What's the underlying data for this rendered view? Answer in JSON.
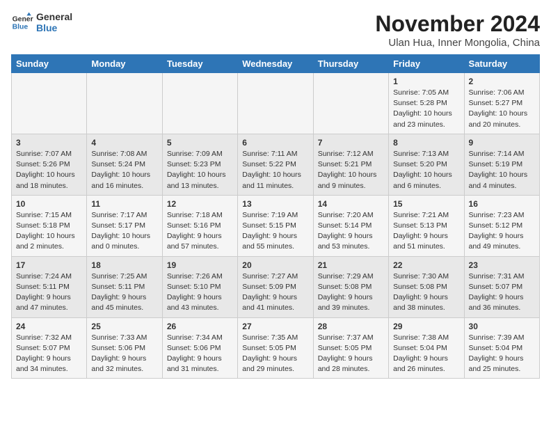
{
  "header": {
    "logo_line1": "General",
    "logo_line2": "Blue",
    "month": "November 2024",
    "location": "Ulan Hua, Inner Mongolia, China"
  },
  "days_of_week": [
    "Sunday",
    "Monday",
    "Tuesday",
    "Wednesday",
    "Thursday",
    "Friday",
    "Saturday"
  ],
  "weeks": [
    [
      {
        "day": "",
        "info": ""
      },
      {
        "day": "",
        "info": ""
      },
      {
        "day": "",
        "info": ""
      },
      {
        "day": "",
        "info": ""
      },
      {
        "day": "",
        "info": ""
      },
      {
        "day": "1",
        "info": "Sunrise: 7:05 AM\nSunset: 5:28 PM\nDaylight: 10 hours\nand 23 minutes."
      },
      {
        "day": "2",
        "info": "Sunrise: 7:06 AM\nSunset: 5:27 PM\nDaylight: 10 hours\nand 20 minutes."
      }
    ],
    [
      {
        "day": "3",
        "info": "Sunrise: 7:07 AM\nSunset: 5:26 PM\nDaylight: 10 hours\nand 18 minutes."
      },
      {
        "day": "4",
        "info": "Sunrise: 7:08 AM\nSunset: 5:24 PM\nDaylight: 10 hours\nand 16 minutes."
      },
      {
        "day": "5",
        "info": "Sunrise: 7:09 AM\nSunset: 5:23 PM\nDaylight: 10 hours\nand 13 minutes."
      },
      {
        "day": "6",
        "info": "Sunrise: 7:11 AM\nSunset: 5:22 PM\nDaylight: 10 hours\nand 11 minutes."
      },
      {
        "day": "7",
        "info": "Sunrise: 7:12 AM\nSunset: 5:21 PM\nDaylight: 10 hours\nand 9 minutes."
      },
      {
        "day": "8",
        "info": "Sunrise: 7:13 AM\nSunset: 5:20 PM\nDaylight: 10 hours\nand 6 minutes."
      },
      {
        "day": "9",
        "info": "Sunrise: 7:14 AM\nSunset: 5:19 PM\nDaylight: 10 hours\nand 4 minutes."
      }
    ],
    [
      {
        "day": "10",
        "info": "Sunrise: 7:15 AM\nSunset: 5:18 PM\nDaylight: 10 hours\nand 2 minutes."
      },
      {
        "day": "11",
        "info": "Sunrise: 7:17 AM\nSunset: 5:17 PM\nDaylight: 10 hours\nand 0 minutes."
      },
      {
        "day": "12",
        "info": "Sunrise: 7:18 AM\nSunset: 5:16 PM\nDaylight: 9 hours\nand 57 minutes."
      },
      {
        "day": "13",
        "info": "Sunrise: 7:19 AM\nSunset: 5:15 PM\nDaylight: 9 hours\nand 55 minutes."
      },
      {
        "day": "14",
        "info": "Sunrise: 7:20 AM\nSunset: 5:14 PM\nDaylight: 9 hours\nand 53 minutes."
      },
      {
        "day": "15",
        "info": "Sunrise: 7:21 AM\nSunset: 5:13 PM\nDaylight: 9 hours\nand 51 minutes."
      },
      {
        "day": "16",
        "info": "Sunrise: 7:23 AM\nSunset: 5:12 PM\nDaylight: 9 hours\nand 49 minutes."
      }
    ],
    [
      {
        "day": "17",
        "info": "Sunrise: 7:24 AM\nSunset: 5:11 PM\nDaylight: 9 hours\nand 47 minutes."
      },
      {
        "day": "18",
        "info": "Sunrise: 7:25 AM\nSunset: 5:11 PM\nDaylight: 9 hours\nand 45 minutes."
      },
      {
        "day": "19",
        "info": "Sunrise: 7:26 AM\nSunset: 5:10 PM\nDaylight: 9 hours\nand 43 minutes."
      },
      {
        "day": "20",
        "info": "Sunrise: 7:27 AM\nSunset: 5:09 PM\nDaylight: 9 hours\nand 41 minutes."
      },
      {
        "day": "21",
        "info": "Sunrise: 7:29 AM\nSunset: 5:08 PM\nDaylight: 9 hours\nand 39 minutes."
      },
      {
        "day": "22",
        "info": "Sunrise: 7:30 AM\nSunset: 5:08 PM\nDaylight: 9 hours\nand 38 minutes."
      },
      {
        "day": "23",
        "info": "Sunrise: 7:31 AM\nSunset: 5:07 PM\nDaylight: 9 hours\nand 36 minutes."
      }
    ],
    [
      {
        "day": "24",
        "info": "Sunrise: 7:32 AM\nSunset: 5:07 PM\nDaylight: 9 hours\nand 34 minutes."
      },
      {
        "day": "25",
        "info": "Sunrise: 7:33 AM\nSunset: 5:06 PM\nDaylight: 9 hours\nand 32 minutes."
      },
      {
        "day": "26",
        "info": "Sunrise: 7:34 AM\nSunset: 5:06 PM\nDaylight: 9 hours\nand 31 minutes."
      },
      {
        "day": "27",
        "info": "Sunrise: 7:35 AM\nSunset: 5:05 PM\nDaylight: 9 hours\nand 29 minutes."
      },
      {
        "day": "28",
        "info": "Sunrise: 7:37 AM\nSunset: 5:05 PM\nDaylight: 9 hours\nand 28 minutes."
      },
      {
        "day": "29",
        "info": "Sunrise: 7:38 AM\nSunset: 5:04 PM\nDaylight: 9 hours\nand 26 minutes."
      },
      {
        "day": "30",
        "info": "Sunrise: 7:39 AM\nSunset: 5:04 PM\nDaylight: 9 hours\nand 25 minutes."
      }
    ]
  ]
}
